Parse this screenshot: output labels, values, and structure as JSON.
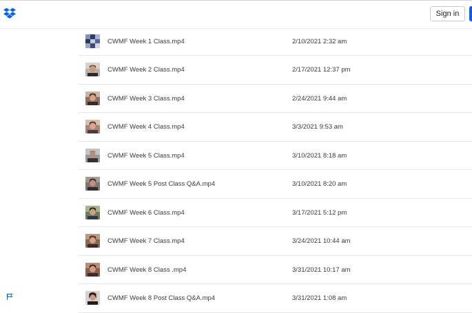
{
  "header": {
    "logo_icon": "dropbox-logo-icon",
    "signin_label": "Sign in",
    "signup_button_color": "#0061fe"
  },
  "colors": {
    "brand": "#0061fe",
    "text": "#3d3a37",
    "divider": "#e6e6e6"
  },
  "files": [
    {
      "name": "CWMF Week 1 Class.mp4",
      "modified": "2/10/2021 2:32 am",
      "thumb": "gallery-thumbnail"
    },
    {
      "name": "CWMF Week 2 Class.mp4",
      "modified": "2/17/2021 12:37 pm",
      "thumb": "video-thumbnail"
    },
    {
      "name": "CWMF Week 3 Class.mp4",
      "modified": "2/24/2021 9:44 am",
      "thumb": "video-thumbnail"
    },
    {
      "name": "CWMF Week 4 Class.mp4",
      "modified": "3/3/2021 9:53 am",
      "thumb": "video-thumbnail"
    },
    {
      "name": "CWMF Week 5 Class.mp4",
      "modified": "3/10/2021 8:18 am",
      "thumb": "video-thumbnail"
    },
    {
      "name": "CWMF Week 5 Post Class Q&A.mp4",
      "modified": "3/10/2021 8:20 am",
      "thumb": "video-thumbnail"
    },
    {
      "name": "CWMF Week 6 Class.mp4",
      "modified": "3/17/2021 5:12 pm",
      "thumb": "video-thumbnail"
    },
    {
      "name": "CWMF Week 7 Class.mp4",
      "modified": "3/24/2021 10:44 am",
      "thumb": "video-thumbnail"
    },
    {
      "name": "CWMF Week 8 Class .mp4",
      "modified": "3/31/2021 10:17 am",
      "thumb": "video-thumbnail"
    },
    {
      "name": "CWMF Week 8 Post Class Q&A.mp4",
      "modified": "3/31/2021 1:08 am",
      "thumb": "video-thumbnail"
    }
  ],
  "footer": {
    "flag_icon": "flag-icon"
  }
}
